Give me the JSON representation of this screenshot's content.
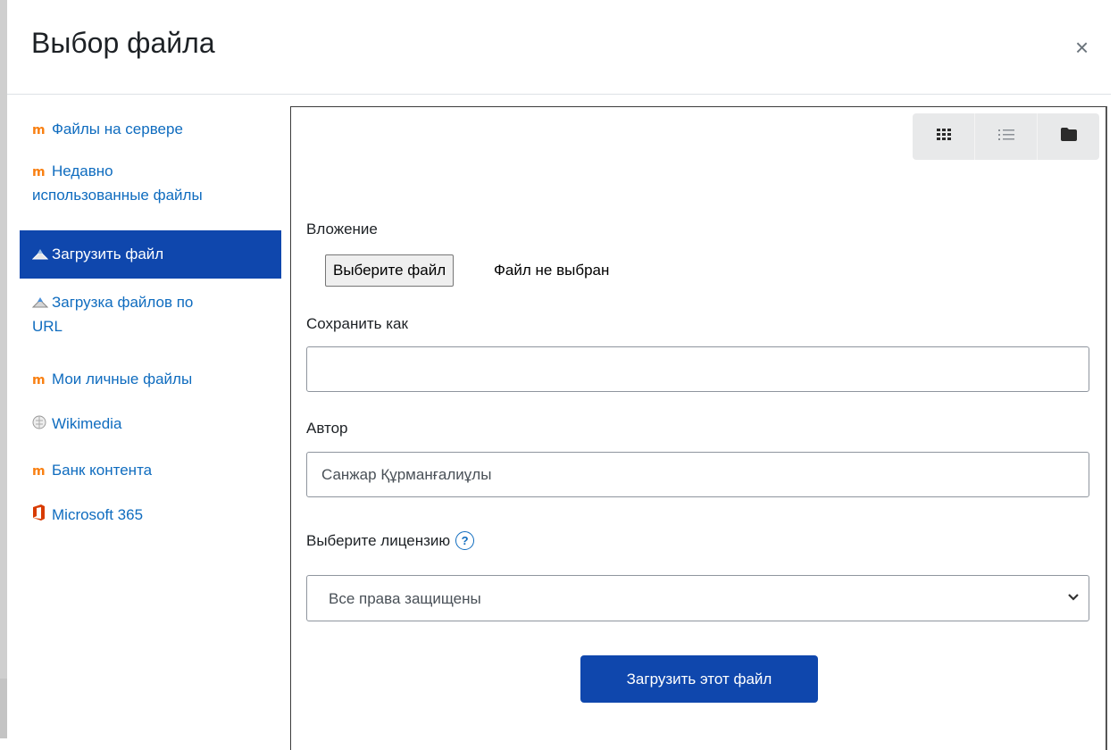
{
  "dialog": {
    "title": "Выбор файла",
    "close_glyph": "×"
  },
  "sidebar": {
    "items": [
      {
        "label": "Файлы на сервере",
        "icon": "moodle-icon"
      },
      {
        "label_line1": "Недавно",
        "label_line2": "использованные файлы",
        "icon": "moodle-icon"
      },
      {
        "label": "Загрузить файл",
        "icon": "upload-icon",
        "active": true
      },
      {
        "label_line1": "Загрузка файлов по",
        "label_line2": "URL",
        "icon": "url-download-icon"
      },
      {
        "label": "Мои личные файлы",
        "icon": "moodle-icon"
      },
      {
        "label": "Wikimedia",
        "icon": "wikimedia-icon"
      },
      {
        "label": "Банк контента",
        "icon": "moodle-icon"
      },
      {
        "label": "Microsoft 365",
        "icon": "office-icon"
      }
    ]
  },
  "viewbar": {
    "icons": [
      "grid-view-icon",
      "list-view-icon",
      "folder-view-icon"
    ]
  },
  "form": {
    "attachment_label": "Вложение",
    "choose_file_button": "Выберите файл",
    "no_file_text": "Файл не выбран",
    "save_as_label": "Сохранить как",
    "save_as_value": "",
    "author_label": "Автор",
    "author_value": "Санжар Құрманғалиұлы",
    "license_label": "Выберите лицензию",
    "license_value": "Все права защищены",
    "submit_button": "Загрузить этот файл"
  },
  "colors": {
    "link": "#0f6cbf",
    "primary": "#0f47ad",
    "moodle_orange": "#f98012",
    "office_orange": "#d83b01"
  }
}
